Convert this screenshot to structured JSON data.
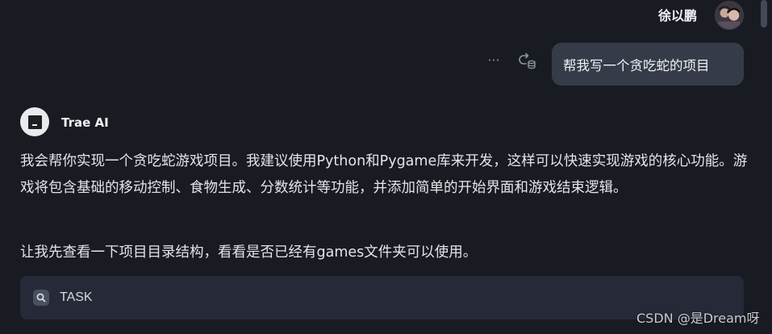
{
  "user": {
    "name": "徐以鹏",
    "message": "帮我写一个贪吃蛇的项目"
  },
  "message_actions": {
    "more_icon": "more-horizontal-icon",
    "more_glyph": "···",
    "retry_icon": "retry-icon"
  },
  "assistant": {
    "name": "Trae AI",
    "paragraphs": [
      "我会帮你实现一个贪吃蛇游戏项目。我建议使用Python和Pygame库来开发，这样可以快速实现游戏的核心功能。游戏将包含基础的移动控制、食物生成、分数统计等功能，并添加简单的开始界面和游戏结束逻辑。",
      "让我先查看一下项目目录结构，看看是否已经有games文件夹可以使用。"
    ]
  },
  "task": {
    "icon": "search-icon",
    "label": "TASK"
  },
  "watermark": "CSDN @是Dream呀",
  "colors": {
    "background": "#181b22",
    "user_bubble": "#363b4a",
    "task_bar": "#252938",
    "text": "#e4e5e9"
  }
}
